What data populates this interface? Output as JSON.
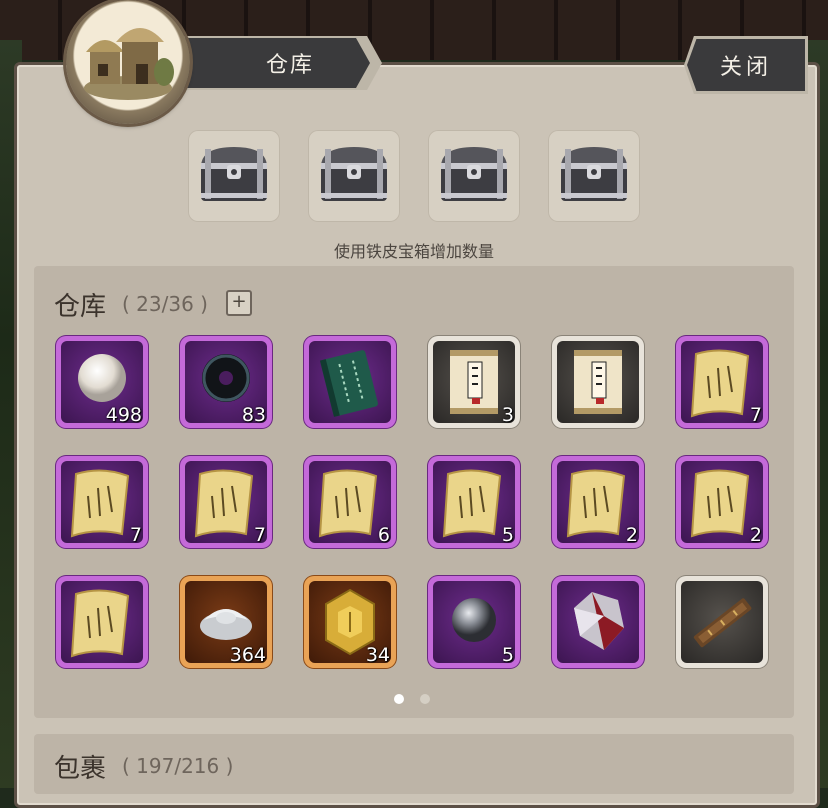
{
  "header": {
    "title": "仓库",
    "close_label": "关闭"
  },
  "chests": {
    "hint": "使用铁皮宝箱增加数量",
    "items": [
      "iron-chest",
      "iron-chest",
      "iron-chest",
      "iron-chest"
    ]
  },
  "storage": {
    "title": "仓库",
    "count": "( 23/36 )",
    "add_label": "+",
    "items": [
      {
        "icon": "pearl-icon",
        "quality": "purple",
        "count": "498"
      },
      {
        "icon": "black-jade-ring-icon",
        "quality": "purple",
        "count": "83"
      },
      {
        "icon": "green-book-icon",
        "quality": "purple",
        "count": ""
      },
      {
        "icon": "scroll-icon",
        "quality": "white",
        "count": "3"
      },
      {
        "icon": "scroll-icon",
        "quality": "white",
        "count": ""
      },
      {
        "icon": "gold-scroll-icon",
        "quality": "purple",
        "count": "7"
      },
      {
        "icon": "gold-scroll-icon",
        "quality": "purple",
        "count": "7"
      },
      {
        "icon": "gold-scroll-icon",
        "quality": "purple",
        "count": "7"
      },
      {
        "icon": "gold-scroll-icon",
        "quality": "purple",
        "count": "6"
      },
      {
        "icon": "gold-scroll-icon",
        "quality": "purple",
        "count": "5"
      },
      {
        "icon": "gold-scroll-icon",
        "quality": "purple",
        "count": "2"
      },
      {
        "icon": "gold-scroll-icon",
        "quality": "purple",
        "count": "2"
      },
      {
        "icon": "gold-scroll-icon",
        "quality": "purple",
        "count": ""
      },
      {
        "icon": "silver-ingot-icon",
        "quality": "orange",
        "count": "364"
      },
      {
        "icon": "gold-token-icon",
        "quality": "orange",
        "count": "34"
      },
      {
        "icon": "iron-ball-icon",
        "quality": "purple",
        "count": "5"
      },
      {
        "icon": "crystal-icon",
        "quality": "purple",
        "count": ""
      },
      {
        "icon": "wooden-plank-icon",
        "quality": "white",
        "count": ""
      }
    ],
    "page_dots": [
      true,
      false
    ]
  },
  "package": {
    "title": "包裹",
    "count": "( 197/216 )"
  },
  "colors": {
    "purple_frame": "#c46ad9",
    "orange_frame": "#e9a356",
    "white_frame": "#e8e3da",
    "panel_bg": "#cbc3b6"
  }
}
